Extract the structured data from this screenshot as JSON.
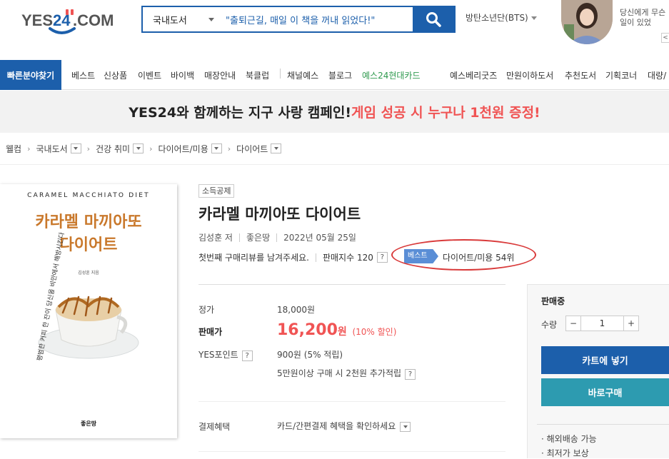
{
  "header": {
    "logo_text": "YES24.COM",
    "search_category": "국내도서",
    "search_value": "\"출퇴근길, 매일 이 책을 꺼내 읽었다!\"",
    "trending": "방탄소년단(BTS)",
    "ad_text": "당신에게 무슨 일이 있었",
    "ad_arrow": "<"
  },
  "nav": {
    "quick_category": "빠른분야찾기",
    "left_links": [
      "베스트",
      "신상품",
      "이벤트",
      "바이백",
      "매장안내",
      "북클럽",
      "채널예스",
      "블로그",
      "예스24현대카드"
    ],
    "right_links": [
      "예스베리굿즈",
      "만원이하도서",
      "추천도서",
      "기획코너",
      "대량/"
    ]
  },
  "banner": {
    "text_main": "YES24와 함께하는 지구 사랑 캠페인! ",
    "text_highlight": "게임 성공 시 누구나 1천원 증정!"
  },
  "breadcrumb": [
    "웰컴",
    "국내도서",
    "건강 취미",
    "다이어트/미용",
    "다이어트"
  ],
  "cover": {
    "top_text": "CARAMEL MACCHIATO DIET",
    "title_line1": "카라멜 마끼아또",
    "title_line2": "다이어트",
    "author": "김성훈 지음",
    "side_text": "평범한 커피 한 잔이 당신을 비만에서 해방시킨다",
    "publisher": "좋은땅"
  },
  "book": {
    "badge": "소득공제",
    "title": "카라멜 마끼아또 다이어트",
    "author": "김성훈 저",
    "publisher": "좋은땅",
    "date": "2022년 05월 25일",
    "review_prompt": "첫번째 구매리뷰를 남겨주세요.",
    "sales_index": "판매지수 120",
    "best_tag": "베스트",
    "best_rank": "다이어트/미용 54위"
  },
  "price": {
    "list_label": "정가",
    "list_price": "18,000원",
    "sale_label": "판매가",
    "sale_price": "16,200",
    "sale_unit": "원",
    "discount": "(10% 할인)",
    "points_label": "YES포인트",
    "points": "900원 (5% 적립)",
    "extra_points": "5만원이상 구매 시 2천원 추가적립",
    "payment_label": "결제혜택",
    "payment_text": "카드/간편결제 혜택을 확인하세요"
  },
  "buybox": {
    "status": "판매중",
    "qty_label": "수량",
    "qty_minus": "−",
    "qty_value": "1",
    "qty_plus": "+",
    "cart_button": "카트에 넣기",
    "buy_button": "바로구매",
    "shipping": [
      "· 해외배송 가능",
      "· 최저가 보상"
    ]
  },
  "qmark": "?"
}
